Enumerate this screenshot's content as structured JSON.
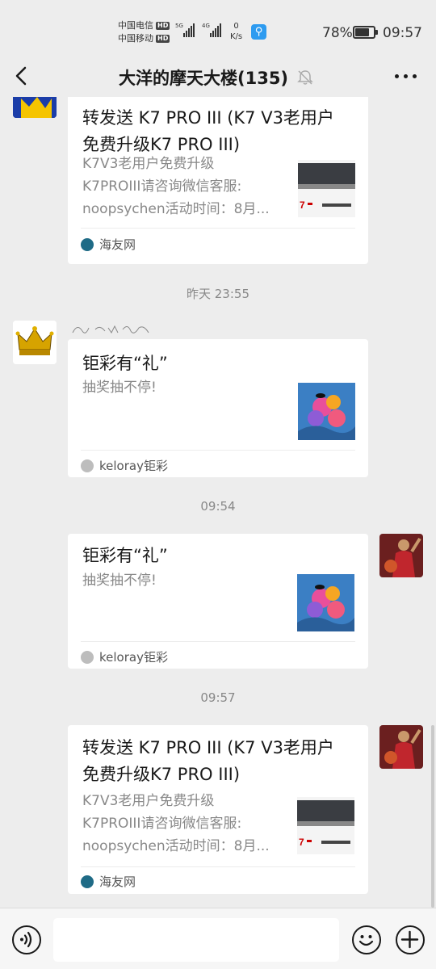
{
  "status_bar": {
    "carrier1": "中国电信",
    "carrier2": "中国移动",
    "hd_badge": "HD",
    "signal1_label": "5G",
    "signal2_label": "4G",
    "net_speed_value": "0",
    "net_speed_unit": "K/s",
    "battery_percent": "78%",
    "battery_level": 0.78,
    "time": "09:57"
  },
  "header": {
    "title": "大洋的摩天大楼(135)",
    "back_icon": "chevron-left-icon",
    "mute_icon": "bell-off-icon",
    "more_icon": "more-dots-icon"
  },
  "messages": [
    {
      "type": "link-card",
      "sender": "other",
      "title": "转发送 K7 PRO III (K7 V3老用户免费升级K7 PRO III)",
      "desc_lines": [
        "K7V3老用户免费升级",
        "K7PROIII请咨询微信客服:",
        "noopsychen活动时间：8月..."
      ],
      "source": "海友网"
    },
    {
      "type": "time",
      "text": "昨天 23:55"
    },
    {
      "type": "link-card",
      "sender": "other",
      "title": "钜彩有“礼”",
      "desc_lines": [
        "抽奖抽不停!"
      ],
      "source": "keloray钜彩"
    },
    {
      "type": "time",
      "text": "09:54"
    },
    {
      "type": "link-card",
      "sender": "me",
      "title": "钜彩有“礼”",
      "desc_lines": [
        "抽奖抽不停!"
      ],
      "source": "keloray钜彩"
    },
    {
      "type": "time",
      "text": "09:57"
    },
    {
      "type": "link-card",
      "sender": "me",
      "title": "转发送 K7 PRO III (K7 V3老用户免费升级K7 PRO III)",
      "desc_lines": [
        "K7V3老用户免费升级",
        "K7PROIII请咨询微信客服:",
        "noopsychen活动时间：8月..."
      ],
      "source": "海友网"
    }
  ],
  "bottom_bar": {
    "voice_icon": "voice-icon",
    "emoji_icon": "emoji-icon",
    "plus_icon": "plus-icon",
    "input_value": ""
  },
  "colors": {
    "background": "#ededed",
    "card": "#ffffff",
    "time_text": "#888888"
  }
}
